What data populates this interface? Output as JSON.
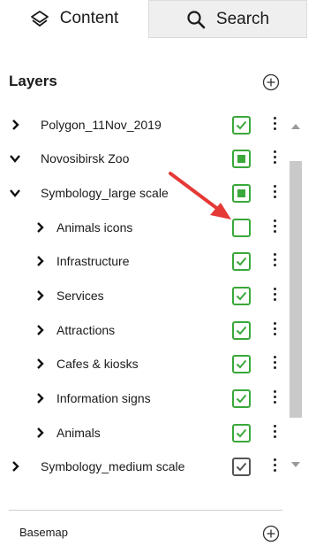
{
  "tabs": [
    {
      "label": "Content",
      "icon": "layers-icon",
      "selected": true
    },
    {
      "label": "Search",
      "icon": "search-icon",
      "selected": false
    }
  ],
  "layers_title": "Layers",
  "tree": [
    {
      "label": "Polygon_11Nov_2019",
      "level": 0,
      "expanded": false,
      "check": "checked",
      "clipped": true
    },
    {
      "label": "Novosibirsk Zoo",
      "level": 0,
      "expanded": true,
      "check": "partial"
    },
    {
      "label": "Symbology_large scale",
      "level": 1,
      "expanded": true,
      "check": "partial"
    },
    {
      "label": "Animals icons",
      "level": 2,
      "expanded": false,
      "check": "unchecked"
    },
    {
      "label": "Infrastructure",
      "level": 2,
      "expanded": false,
      "check": "checked"
    },
    {
      "label": "Services",
      "level": 2,
      "expanded": false,
      "check": "checked"
    },
    {
      "label": "Attractions",
      "level": 2,
      "expanded": false,
      "check": "checked"
    },
    {
      "label": "Cafes & kiosks",
      "level": 2,
      "expanded": false,
      "check": "checked"
    },
    {
      "label": "Information signs",
      "level": 2,
      "expanded": false,
      "check": "checked"
    },
    {
      "label": "Animals",
      "level": 2,
      "expanded": false,
      "check": "checked"
    },
    {
      "label": "Symbology_medium scale",
      "level": 1,
      "expanded": false,
      "check": "checked-gray",
      "clipped": true
    }
  ],
  "basemap_label": "Basemap",
  "colors": {
    "check_green": "#3aa83a",
    "arrow_red": "#e53935",
    "tab_inactive_bg": "#efefef"
  }
}
